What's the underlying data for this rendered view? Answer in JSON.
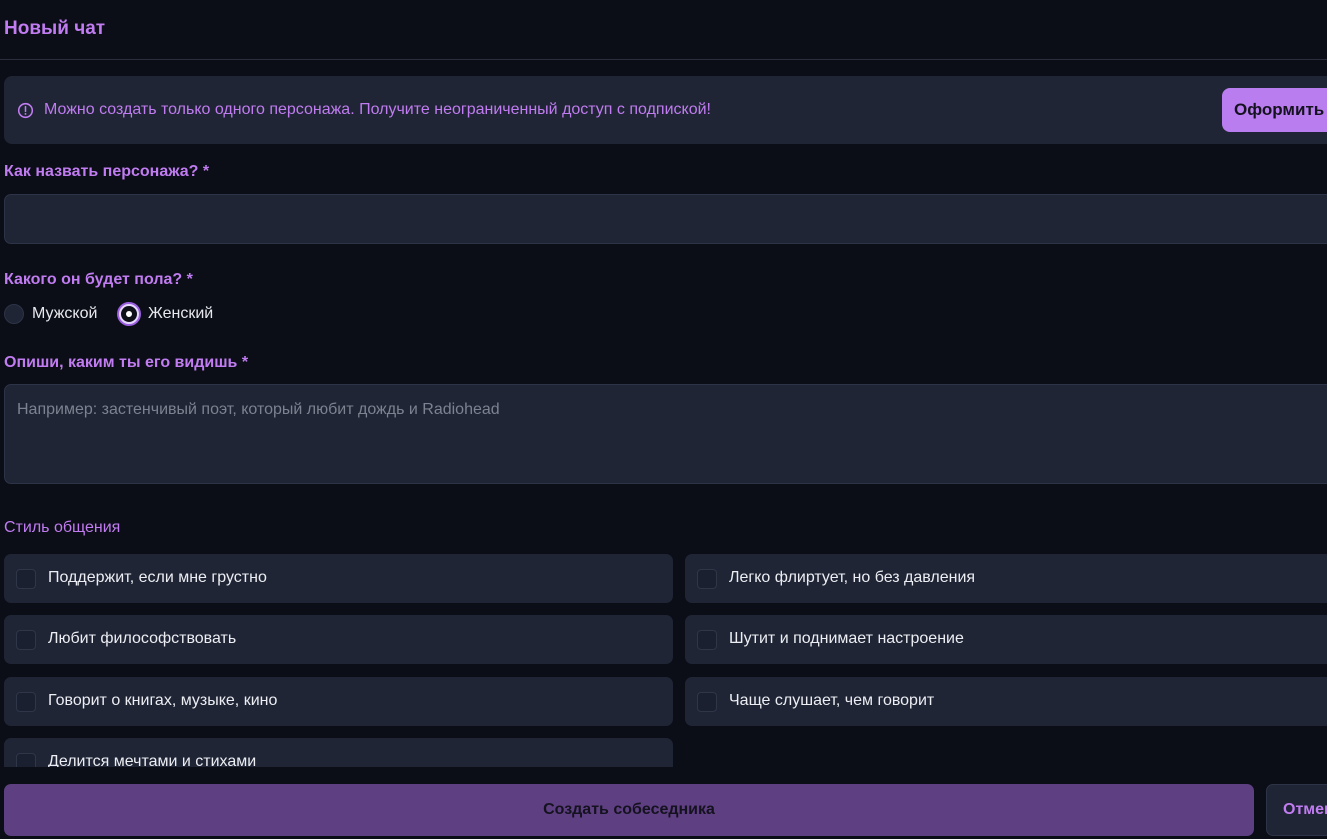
{
  "header": {
    "title": "Новый чат"
  },
  "banner": {
    "icon": "info-circle-icon",
    "message": "Можно создать только одного персонажа. Получите неограниченный доступ с подпиской!",
    "subscribe_label": "Оформить"
  },
  "form": {
    "name_label": "Как назвать персонажа? *",
    "name_value": "",
    "gender_label": "Какого он будет пола? *",
    "gender_options": [
      {
        "label": "Мужской",
        "selected": false
      },
      {
        "label": "Женский",
        "selected": true
      }
    ],
    "description_label": "Опиши, каким ты его видишь *",
    "description_placeholder": "Например: застенчивый поэт, который любит дождь и Radiohead",
    "style_label": "Стиль общения",
    "style_options": [
      {
        "label": "Поддержит, если мне грустно",
        "checked": false
      },
      {
        "label": "Легко флиртует, но без давления",
        "checked": false
      },
      {
        "label": "Любит философствовать",
        "checked": false
      },
      {
        "label": "Шутит и поднимает настроение",
        "checked": false
      },
      {
        "label": "Говорит о книгах, музыке, кино",
        "checked": false
      },
      {
        "label": "Чаще слушает, чем говорит",
        "checked": false
      },
      {
        "label": "Делится мечтами и стихами",
        "checked": false
      }
    ]
  },
  "footer": {
    "create_label": "Создать собеседника",
    "cancel_label": "Отмена"
  },
  "colors": {
    "accent": "#c07cf0",
    "background": "#0b0d17",
    "panel": "#1f2535",
    "primary_button": "#5e3f82"
  }
}
